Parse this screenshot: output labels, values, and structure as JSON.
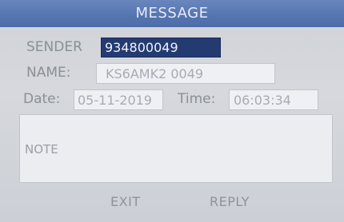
{
  "header": {
    "title": "MESSAGE"
  },
  "form": {
    "sender_label": "SENDER",
    "sender_value": "934800049",
    "name_label": "NAME:",
    "name_value": "KS6AMK2 0049",
    "date_label": "Date:",
    "date_value": "05-11-2019",
    "time_label": "Time:",
    "time_value": "06:03:34",
    "note_label": "NOTE"
  },
  "softkeys": {
    "left": "EXIT",
    "right": "REPLY"
  },
  "colors": {
    "title_bar": "#5676b2",
    "selected_field": "#243b72",
    "field_background": "#eef0f3",
    "screen_background": "#d6d8dd"
  }
}
